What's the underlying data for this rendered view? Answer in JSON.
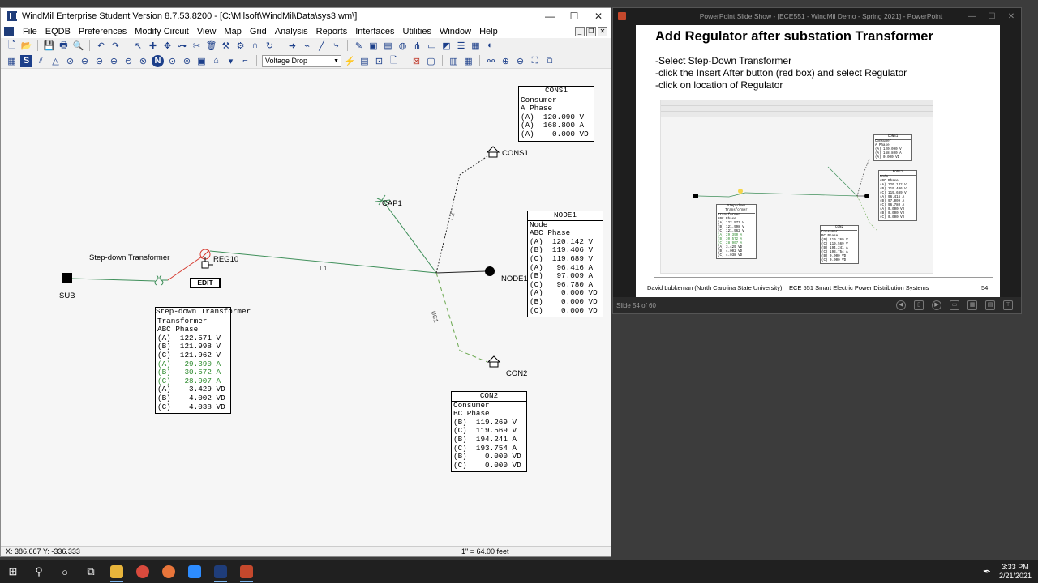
{
  "windmil": {
    "title": "WindMil Enterprise Student Version 8.7.53.8200 - [C:\\Milsoft\\WindMil\\Data\\sys3.wm\\]",
    "menu": [
      "File",
      "EQDB",
      "Preferences",
      "Modify Circuit",
      "View",
      "Map",
      "Grid",
      "Analysis",
      "Reports",
      "Interfaces",
      "Utilities",
      "Window",
      "Help"
    ],
    "dropdown_value": "Voltage Drop",
    "status_coords": "X: 386.667  Y: -336.333",
    "status_scale": "1\" = 64.00 feet",
    "edit_button": "EDIT",
    "labels": {
      "sub": "SUB",
      "transformer": "Step-down Transformer",
      "reg": "REG10",
      "cap": "CAP1",
      "node": "NODE1",
      "cons1": "CONS1",
      "con2": "CON2",
      "l1": "L1",
      "l2": "L2",
      "ug1": "UG1"
    },
    "boxes": {
      "cons1": {
        "title": "CONS1",
        "lines": [
          "Consumer",
          "A Phase",
          "(A)  120.090 V",
          "(A)  168.800 A",
          "(A)    0.000 VD"
        ]
      },
      "node1": {
        "title": "NODE1",
        "lines": [
          "Node",
          "ABC Phase",
          "(A)  120.142 V",
          "(B)  119.406 V",
          "(C)  119.689 V",
          "(A)   96.416 A",
          "(B)   97.009 A",
          "(C)   96.780 A",
          "(A)    0.000 VD",
          "(B)    0.000 VD",
          "(C)    0.000 VD"
        ]
      },
      "transformer": {
        "title": "Step-down Transformer",
        "lines": [
          "Transformer",
          "ABC Phase",
          "(A)  122.571 V",
          "(B)  121.998 V",
          "(C)  121.962 V",
          "(A)   29.390 A",
          "(B)   30.572 A",
          "(C)   28.907 A",
          "(A)    3.429 VD",
          "(B)    4.002 VD",
          "(C)    4.038 VD"
        ]
      },
      "con2": {
        "title": "CON2",
        "lines": [
          "Consumer",
          "BC Phase",
          "(B)  119.269 V",
          "(C)  119.569 V",
          "(B)  194.241 A",
          "(C)  193.754 A",
          "(B)    0.000 VD",
          "(C)    0.000 VD"
        ]
      }
    }
  },
  "powerpoint": {
    "title": "PowerPoint Slide Show - [ECE551 - WindMil Demo - Spring 2021] - PowerPoint",
    "slide_title": "Add Regulator after substation Transformer",
    "bullets": [
      "-Select Step-Down Transformer",
      "-click the Insert After button (red box) and select Regulator",
      "-click on location of Regulator"
    ],
    "footer_left": "David Lubkeman (North Carolina State University)",
    "footer_mid": "ECE 551 Smart Electric Power Distribution Systems",
    "footer_page": "54",
    "status": "Slide 54 of 60"
  },
  "taskbar": {
    "time": "3:33 PM",
    "date": "2/21/2021"
  },
  "colors": {
    "line_green": "#3f8f5a",
    "line_red": "#d63a2f",
    "ug_green": "#6aa84f",
    "highlight_green": "#2e8b2e"
  }
}
